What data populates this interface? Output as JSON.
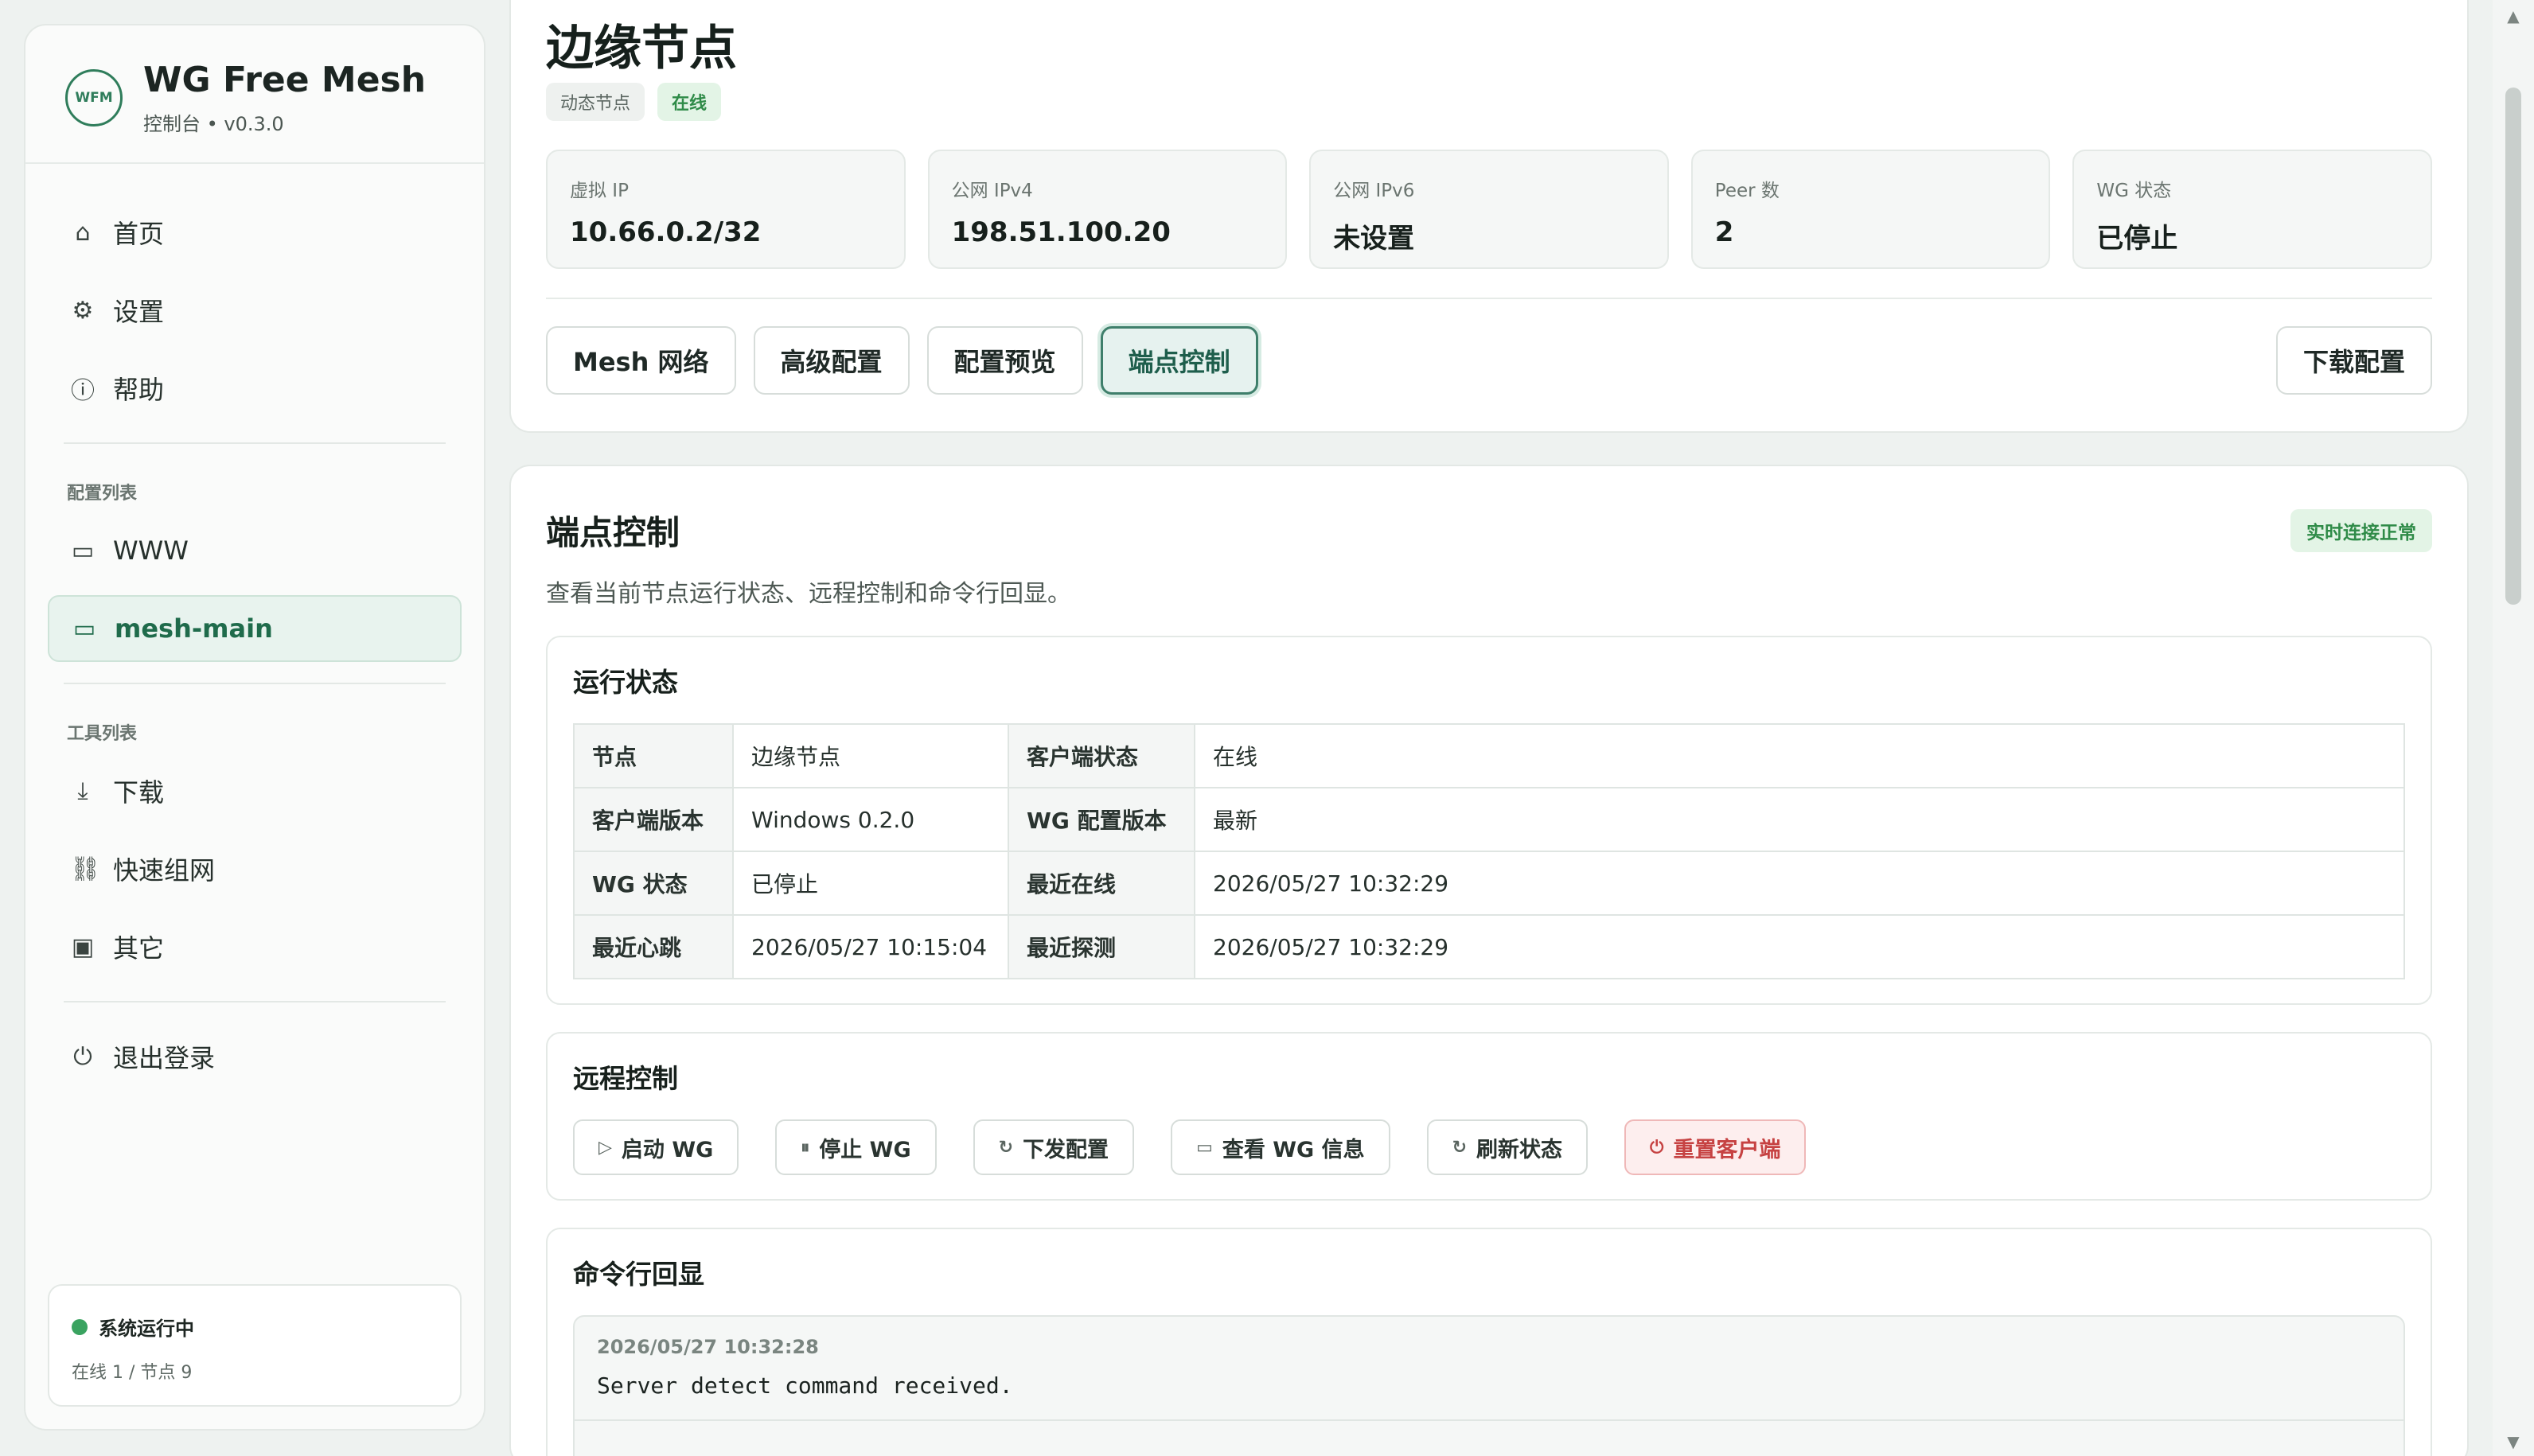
{
  "brand": {
    "logo_text": "WFM",
    "title": "WG Free Mesh",
    "subtitle": "控制台 • v0.3.0"
  },
  "nav": {
    "main": [
      {
        "label": "首页",
        "icon": "home-icon"
      },
      {
        "label": "设置",
        "icon": "gear-icon"
      },
      {
        "label": "帮助",
        "icon": "info-icon"
      }
    ],
    "config_section": "配置列表",
    "configs": [
      {
        "label": "WWW",
        "icon": "folder-icon"
      },
      {
        "label": "mesh-main",
        "icon": "folder-icon",
        "active": true
      }
    ],
    "tool_section": "工具列表",
    "tools": [
      {
        "label": "下载",
        "icon": "download-icon"
      },
      {
        "label": "快速组网",
        "icon": "link-icon"
      },
      {
        "label": "其它",
        "icon": "box-icon"
      }
    ],
    "logout": "退出登录"
  },
  "system_status": {
    "label": "系统运行中",
    "detail": "在线 1 / 节点 9"
  },
  "header": {
    "title": "边缘节点",
    "badges": [
      "动态节点",
      "在线"
    ],
    "stats": [
      {
        "label": "虚拟 IP",
        "value": "10.66.0.2/32"
      },
      {
        "label": "公网 IPv4",
        "value": "198.51.100.20"
      },
      {
        "label": "公网 IPv6",
        "value": "未设置"
      },
      {
        "label": "Peer 数",
        "value": "2"
      },
      {
        "label": "WG 状态",
        "value": "已停止"
      }
    ],
    "tabs": [
      "Mesh 网络",
      "高级配置",
      "配置预览",
      "端点控制"
    ],
    "download_label": "下载配置"
  },
  "control": {
    "title": "端点控制",
    "live_badge": "实时连接正常",
    "description": "查看当前节点运行状态、远程控制和命令行回显。",
    "runtime": {
      "title": "运行状态",
      "rows": [
        [
          "节点",
          "边缘节点",
          "客户端状态",
          "在线"
        ],
        [
          "客户端版本",
          "Windows 0.2.0",
          "WG 配置版本",
          "最新"
        ],
        [
          "WG 状态",
          "已停止",
          "最近在线",
          "2026/05/27 10:32:29"
        ],
        [
          "最近心跳",
          "2026/05/27 10:15:04",
          "最近探测",
          "2026/05/27 10:32:29"
        ]
      ]
    },
    "remote": {
      "title": "远程控制",
      "buttons": [
        {
          "label": "启动 WG",
          "icon": "play-icon"
        },
        {
          "label": "停止 WG",
          "icon": "pause-icon"
        },
        {
          "label": "下发配置",
          "icon": "refresh-icon"
        },
        {
          "label": "查看 WG 信息",
          "icon": "monitor-icon"
        },
        {
          "label": "刷新状态",
          "icon": "refresh-icon"
        },
        {
          "label": "重置客户端",
          "icon": "power-icon"
        }
      ]
    },
    "console": {
      "title": "命令行回显",
      "timestamp": "2026/05/27 10:32:28",
      "line": "Server detect command received."
    }
  }
}
